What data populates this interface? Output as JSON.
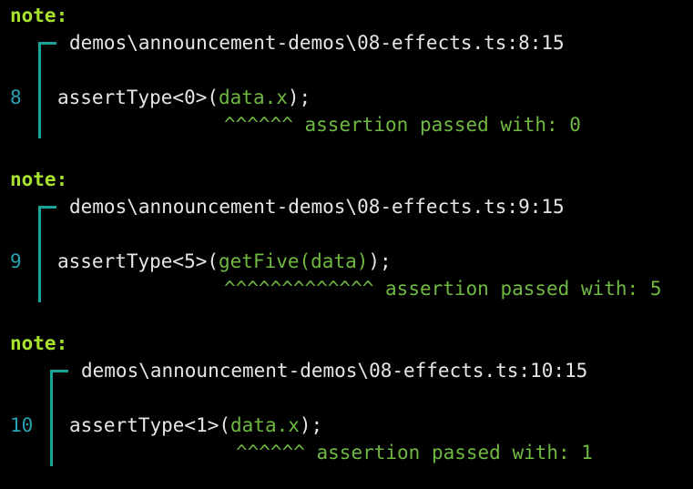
{
  "notes": [
    {
      "label": "note:",
      "path": "demos\\announcement-demos\\08-effects.ts:8:15",
      "line_number": "8",
      "code_before": "assertType<0>(",
      "code_highlight": "data.x",
      "code_after": ");",
      "carets": "^^^^^^",
      "message": "assertion passed with: 0"
    },
    {
      "label": "note:",
      "path": "demos\\announcement-demos\\08-effects.ts:9:15",
      "line_number": "9",
      "code_before": "assertType<5>(",
      "code_highlight": "getFive(data)",
      "code_after": ");",
      "carets": "^^^^^^^^^^^^^",
      "message": "assertion passed with: 5"
    },
    {
      "label": "note:",
      "path": "demos\\announcement-demos\\08-effects.ts:10:15",
      "line_number": "10",
      "code_before": "assertType<1>(",
      "code_highlight": "data.x",
      "code_after": ");",
      "carets": "^^^^^^",
      "message": "assertion passed with: 1"
    }
  ],
  "colors": {
    "background": "#000000",
    "note_label": "#a6e22e",
    "bracket": "#1aa39a",
    "line_number": "#2aa1b3",
    "highlight": "#6fb841",
    "text": "#e6e6e6"
  }
}
